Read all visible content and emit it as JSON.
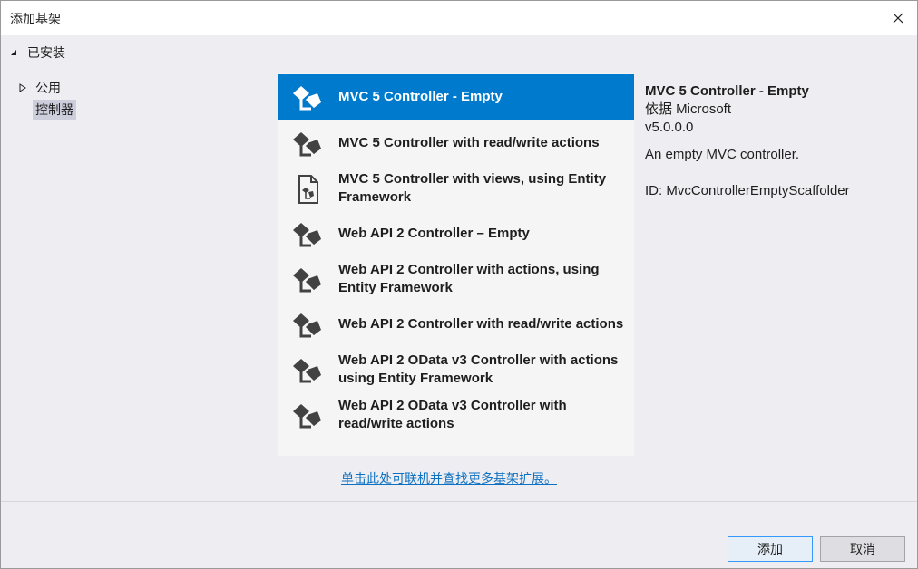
{
  "window": {
    "title": "添加基架"
  },
  "tree": {
    "root_label": "已安装",
    "items": [
      {
        "label": "公用"
      },
      {
        "label": "控制器"
      }
    ]
  },
  "templates": [
    {
      "label": "MVC 5 Controller - Empty"
    },
    {
      "label": "MVC 5 Controller with read/write actions"
    },
    {
      "label": "MVC 5 Controller with views, using Entity Framework"
    },
    {
      "label": "Web API 2 Controller – Empty"
    },
    {
      "label": "Web API 2 Controller with actions, using Entity Framework"
    },
    {
      "label": "Web API 2 Controller with read/write actions"
    },
    {
      "label": "Web API 2 OData v3 Controller with actions using Entity Framework"
    },
    {
      "label": "Web API 2 OData v3 Controller with read/write actions"
    }
  ],
  "details": {
    "name": "MVC 5 Controller - Empty",
    "author": "依据 Microsoft",
    "version": "v5.0.0.0",
    "description": "An empty MVC controller.",
    "id": "ID: MvcControllerEmptyScaffolder"
  },
  "online_link": "单击此处可联机并查找更多基架扩展。",
  "buttons": {
    "add": "添加",
    "cancel": "取消"
  },
  "colors": {
    "selected": "#007acc",
    "link": "#0e70c0",
    "icon": "#424242"
  }
}
